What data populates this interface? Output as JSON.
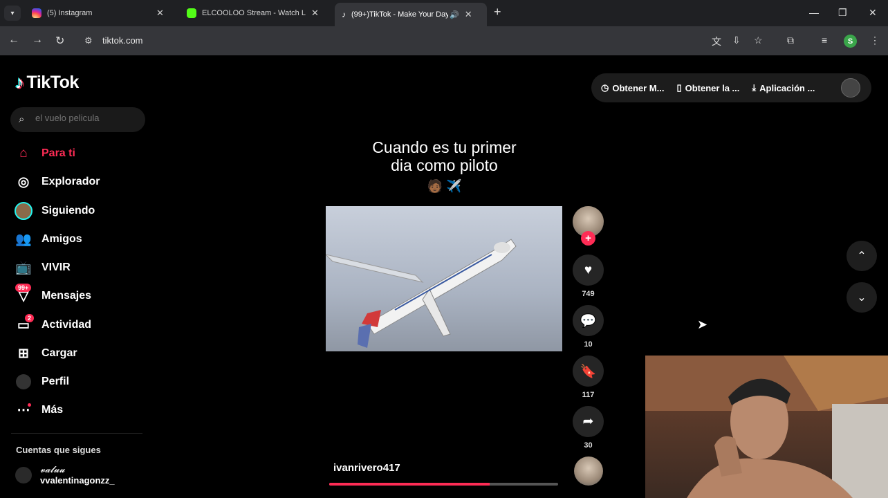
{
  "browser": {
    "tabs": [
      {
        "title": "(5) Instagram",
        "favicon_color": "#d62976"
      },
      {
        "title": "ELCOOLOO Stream - Watch Live",
        "favicon_color": "#53fc18"
      },
      {
        "title": "(99+)TikTok - Make Your Day",
        "favicon_color": "#ffffff"
      }
    ],
    "new_tab": "+",
    "url": "tiktok.com",
    "profile_initial": "S"
  },
  "tiktok": {
    "logo": "TikTok",
    "search": {
      "placeholder": "el vuelo pelicula"
    },
    "nav": [
      {
        "label": "Para ti",
        "icon": "home-icon"
      },
      {
        "label": "Explorador",
        "icon": "compass-icon"
      },
      {
        "label": "Siguiendo",
        "icon": "following-avatar-icon"
      },
      {
        "label": "Amigos",
        "icon": "friends-icon"
      },
      {
        "label": "VIVIR",
        "icon": "live-tv-icon"
      },
      {
        "label": "Mensajes",
        "icon": "messages-icon",
        "badge": "99+"
      },
      {
        "label": "Actividad",
        "icon": "activity-icon",
        "badge": "2"
      },
      {
        "label": "Cargar",
        "icon": "upload-icon"
      },
      {
        "label": "Perfil",
        "icon": "profile-avatar-icon"
      },
      {
        "label": "Más",
        "icon": "more-icon"
      }
    ],
    "following_header": "Cuentas que sigues",
    "followed_account": {
      "display": "𝓿𝓪𝓵𝓾𝓾",
      "handle": "vvalentinagonzz_"
    },
    "topbar": [
      {
        "label": "Obtener M...",
        "icon": "coins-icon"
      },
      {
        "label": "Obtener la ...",
        "icon": "phone-icon"
      },
      {
        "label": "Aplicación ...",
        "icon": "download-icon"
      }
    ],
    "video": {
      "caption_line1": "Cuando es tu primer",
      "caption_line2": "dia como piloto",
      "caption_emoji": "🧑🏾 ✈️",
      "username": "ivanrivero417",
      "progress": 0.7,
      "likes": "749",
      "comments": "10",
      "saves": "117",
      "shares": "30"
    }
  }
}
